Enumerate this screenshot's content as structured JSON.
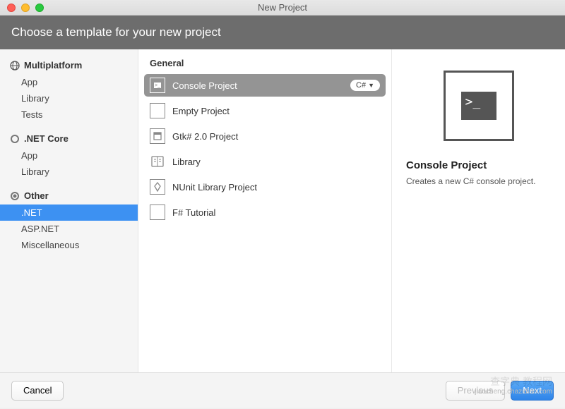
{
  "window": {
    "title": "New Project"
  },
  "header": {
    "text": "Choose a template for your new project"
  },
  "sidebar": {
    "categories": [
      {
        "name": "Multiplatform",
        "icon": "globe",
        "items": [
          "App",
          "Library",
          "Tests"
        ],
        "selected": null
      },
      {
        "name": ".NET Core",
        "icon": "radio-off",
        "items": [
          "App",
          "Library"
        ],
        "selected": null
      },
      {
        "name": "Other",
        "icon": "radio-on",
        "items": [
          ".NET",
          "ASP.NET",
          "Miscellaneous"
        ],
        "selected": 0
      }
    ]
  },
  "center": {
    "group": "General",
    "templates": [
      {
        "label": "Console Project",
        "icon": "console",
        "selected": true,
        "lang": "C#"
      },
      {
        "label": "Empty Project",
        "icon": "empty"
      },
      {
        "label": "Gtk# 2.0 Project",
        "icon": "gtk"
      },
      {
        "label": "Library",
        "icon": "library"
      },
      {
        "label": "NUnit Library Project",
        "icon": "nunit"
      },
      {
        "label": "F# Tutorial",
        "icon": "fsharp"
      }
    ]
  },
  "preview": {
    "title": "Console Project",
    "desc": "Creates a new C# console project.",
    "glyph": ">_"
  },
  "footer": {
    "cancel": "Cancel",
    "previous": "Previous",
    "next": "Next"
  },
  "watermark": {
    "cn": "查字典 教程网",
    "en": "jiaocheng.chazidian.com"
  }
}
